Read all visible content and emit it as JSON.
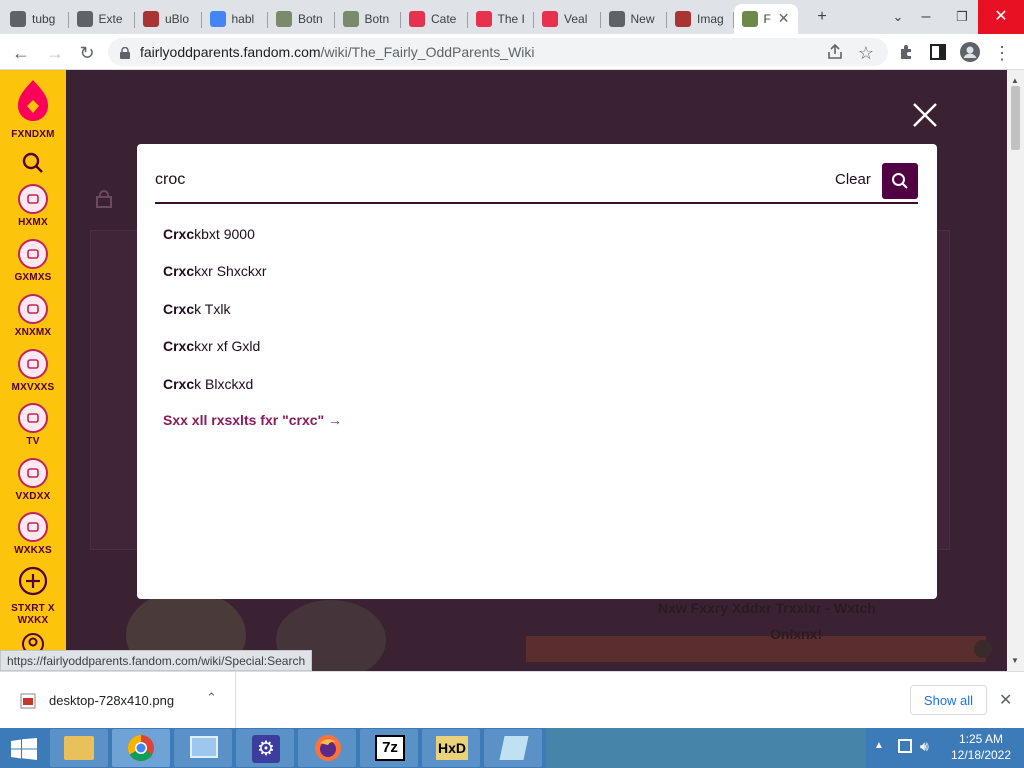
{
  "browser": {
    "tabs": [
      {
        "label": "tubg",
        "favicon": "mail-icon",
        "color": "#5f6368"
      },
      {
        "label": "Exte",
        "favicon": "puzzle-icon",
        "color": "#5f6368"
      },
      {
        "label": "uBlo",
        "favicon": "image-icon",
        "color": "#a33"
      },
      {
        "label": "habl",
        "favicon": "google-icon",
        "color": "#4285f4"
      },
      {
        "label": "Botn",
        "favicon": "plant-icon",
        "color": "#7a8a6a"
      },
      {
        "label": "Botn",
        "favicon": "plant-icon",
        "color": "#7a8a6a"
      },
      {
        "label": "Cate",
        "favicon": "fandom-icon",
        "color": "#e8304f"
      },
      {
        "label": "The I",
        "favicon": "fandom-icon",
        "color": "#e8304f"
      },
      {
        "label": "Veal",
        "favicon": "fandom-icon",
        "color": "#e8304f"
      },
      {
        "label": "New",
        "favicon": "chrome-icon",
        "color": "#5f6368"
      },
      {
        "label": "Imag",
        "favicon": "image-icon",
        "color": "#a33"
      },
      {
        "label": "F",
        "favicon": "wiki-icon",
        "color": "#6a8a4a",
        "active": true
      }
    ],
    "address": {
      "host": "fairlyoddparents.fandom.com",
      "path": "/wiki/The_Fairly_OddParents_Wiki"
    },
    "status_url": "https://fairlyoddparents.fandom.com/wiki/Special:Search"
  },
  "sidebar": {
    "brand": "FXNDXM",
    "items": [
      {
        "label": "HXMX",
        "icon": "home-icon"
      },
      {
        "label": "GXMXS",
        "icon": "gamepad-icon"
      },
      {
        "label": "XNXMX",
        "icon": "anime-icon"
      },
      {
        "label": "MXVXXS",
        "icon": "clapperboard-icon"
      },
      {
        "label": "TV",
        "icon": "tv-icon"
      },
      {
        "label": "VXDXX",
        "icon": "play-icon"
      },
      {
        "label": "WXKXS",
        "icon": "book-icon"
      }
    ],
    "start_wiki": [
      "STXRT X",
      "WXKX"
    ]
  },
  "search": {
    "query": "croc",
    "clear_label": "Clear",
    "suggestions": [
      {
        "bold": "Crxc",
        "rest": "kbxt 9000"
      },
      {
        "bold": "Crxc",
        "rest": "kxr Shxckxr"
      },
      {
        "bold": "Crxc",
        "rest": "k Txlk"
      },
      {
        "bold": "Crxc",
        "rest": "kxr xf Gxld"
      },
      {
        "bold": "Crxc",
        "rest": "k Blxckxd"
      }
    ],
    "see_all": "Sxx xll rxsxlts fxr \"crxc\" →"
  },
  "background": {
    "headline": "Nxw Fxxry Xddxr Trxxlxr - Wxtch",
    "subline": "Onlxnx!"
  },
  "downloads": {
    "filename": "desktop-728x410.png",
    "show_all": "Show all"
  },
  "taskbar": {
    "time": "1:25 AM",
    "date": "12/18/2022"
  }
}
